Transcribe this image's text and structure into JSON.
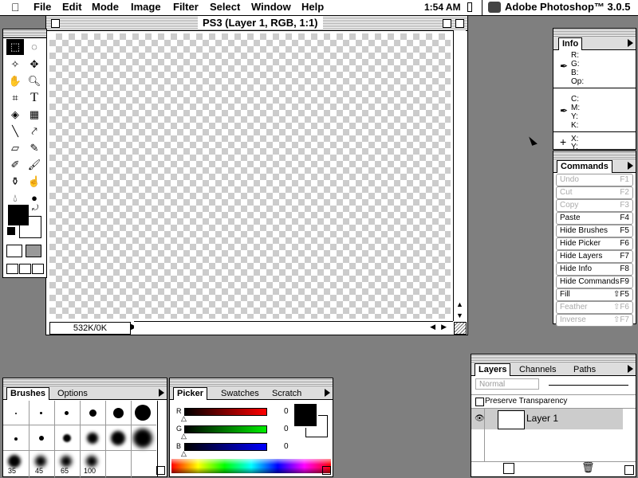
{
  "menubar": {
    "items": [
      "File",
      "Edit",
      "Mode",
      "Image",
      "Filter",
      "Select",
      "Window",
      "Help"
    ],
    "clock": "1:54 AM",
    "app_name": "Adobe Photoshop™ 3.0.5"
  },
  "document": {
    "title": "PS3 (Layer 1, RGB, 1:1)",
    "size_info": "532K/0K"
  },
  "toolbox": {
    "tools": [
      "marquee",
      "lasso",
      "magic-wand",
      "move",
      "hand",
      "zoom",
      "crop",
      "type",
      "paint-bucket",
      "gradient",
      "line",
      "eyedropper",
      "eraser",
      "pencil",
      "airbrush",
      "paintbrush",
      "rubber-stamp",
      "smudge",
      "blur",
      "burn"
    ]
  },
  "info": {
    "tab": "Info",
    "rgb_labels": [
      "R:",
      "G:",
      "B:",
      "Op:"
    ],
    "cmyk_labels": [
      "C:",
      "M:",
      "Y:",
      "K:"
    ],
    "xy_labels": [
      "X:",
      "Y:"
    ]
  },
  "commands": {
    "tab": "Commands",
    "items": [
      {
        "name": "Undo",
        "key": "F1",
        "enabled": false
      },
      {
        "name": "Cut",
        "key": "F2",
        "enabled": false
      },
      {
        "name": "Copy",
        "key": "F3",
        "enabled": false
      },
      {
        "name": "Paste",
        "key": "F4",
        "enabled": true
      },
      {
        "name": "Hide Brushes",
        "key": "F5",
        "enabled": true
      },
      {
        "name": "Hide Picker",
        "key": "F6",
        "enabled": true
      },
      {
        "name": "Hide Layers",
        "key": "F7",
        "enabled": true
      },
      {
        "name": "Hide Info",
        "key": "F8",
        "enabled": true
      },
      {
        "name": "Hide Commands",
        "key": "F9",
        "enabled": true
      },
      {
        "name": "Fill",
        "key": "⇧F5",
        "enabled": true
      },
      {
        "name": "Feather",
        "key": "⇧F6",
        "enabled": false
      },
      {
        "name": "Inverse",
        "key": "⇧F7",
        "enabled": false
      }
    ]
  },
  "layers": {
    "tabs": [
      "Layers",
      "Channels",
      "Paths"
    ],
    "mode": "Normal",
    "preserve_transparency": "Preserve Transparency",
    "layer_name": "Layer 1"
  },
  "brushes": {
    "tabs": [
      "Brushes",
      "Options"
    ],
    "labels": [
      "35",
      "45",
      "65",
      "100"
    ]
  },
  "picker": {
    "tabs": [
      "Picker",
      "Swatches",
      "Scratch"
    ],
    "channels": [
      {
        "label": "R",
        "value": "0",
        "color": "#ff0000"
      },
      {
        "label": "G",
        "value": "0",
        "color": "#00cc00"
      },
      {
        "label": "B",
        "value": "0",
        "color": "#0000ff"
      }
    ]
  },
  "colors": {
    "desktop": "#7f7f7f",
    "foreground": "#000000",
    "background": "#ffffff"
  }
}
